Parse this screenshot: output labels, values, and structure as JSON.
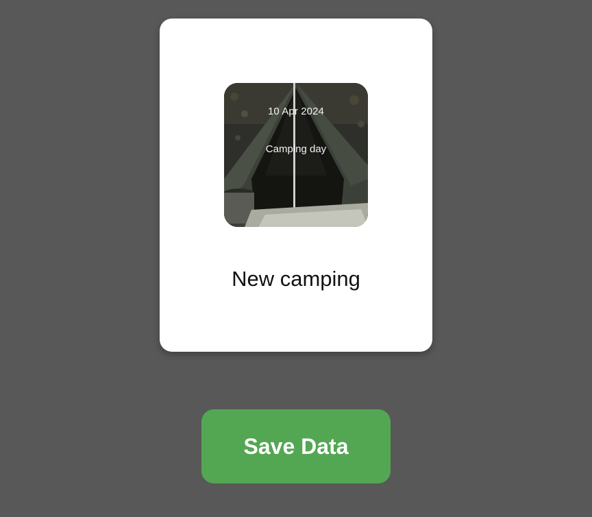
{
  "card": {
    "photo": {
      "icon": "tent-photo",
      "date": "10 Apr 2024",
      "caption": "Camping day"
    },
    "title": "New camping"
  },
  "actions": {
    "save_label": "Save Data"
  },
  "colors": {
    "background": "#585858",
    "card": "#ffffff",
    "save_button": "#53a753"
  }
}
